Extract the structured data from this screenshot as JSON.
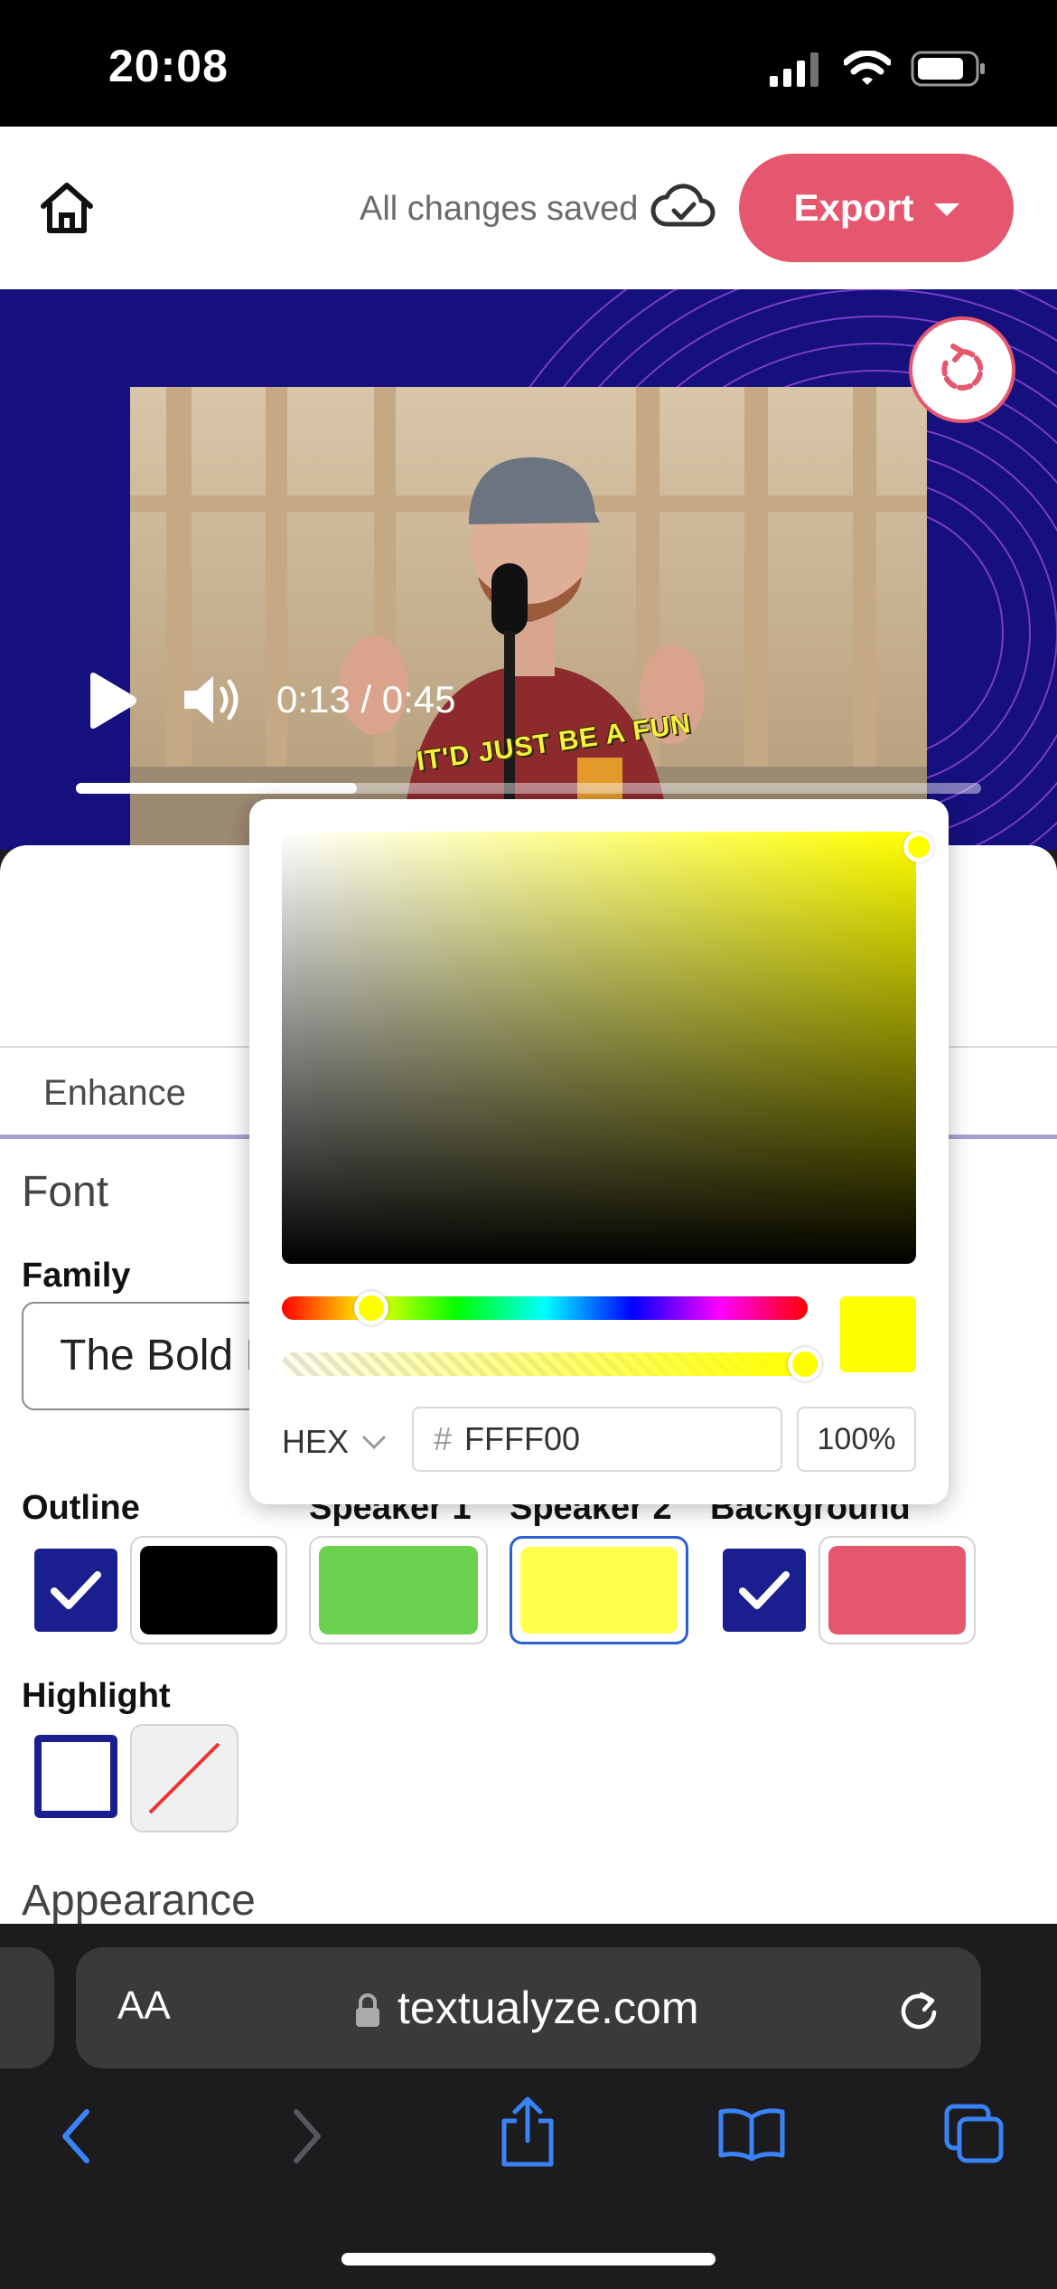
{
  "status_bar": {
    "time": "20:08"
  },
  "header": {
    "save_status": "All changes saved",
    "export_label": "Export"
  },
  "video": {
    "time": "0:13 / 0:45",
    "progress": 0.31,
    "caption": "IT'D JUST BE A FUN"
  },
  "editor": {
    "tab": "Enhance",
    "font_heading": "Font",
    "family_label": "Family",
    "family_value": "The Bold F",
    "swatches": {
      "outline": {
        "label": "Outline",
        "checked": true,
        "color": "#000000"
      },
      "speaker1": {
        "label": "Speaker 1",
        "color": "#6cd04f"
      },
      "speaker2": {
        "label": "Speaker 2",
        "color": "#ffff4d"
      },
      "background": {
        "label": "Background",
        "checked": true,
        "color": "#e5576f"
      }
    },
    "highlight": {
      "label": "Highlight",
      "checked": false
    },
    "appearance_heading": "Appearance"
  },
  "color_picker": {
    "mode": "HEX",
    "hex_value": "FFFF00",
    "alpha": "100%",
    "color": "#ffff00"
  },
  "browser": {
    "reader_label": "AA",
    "url": "textualyze.com"
  },
  "colors": {
    "accent": "#e5576f",
    "navy": "#1b1e8e",
    "ios_blue": "#3a82f7"
  }
}
